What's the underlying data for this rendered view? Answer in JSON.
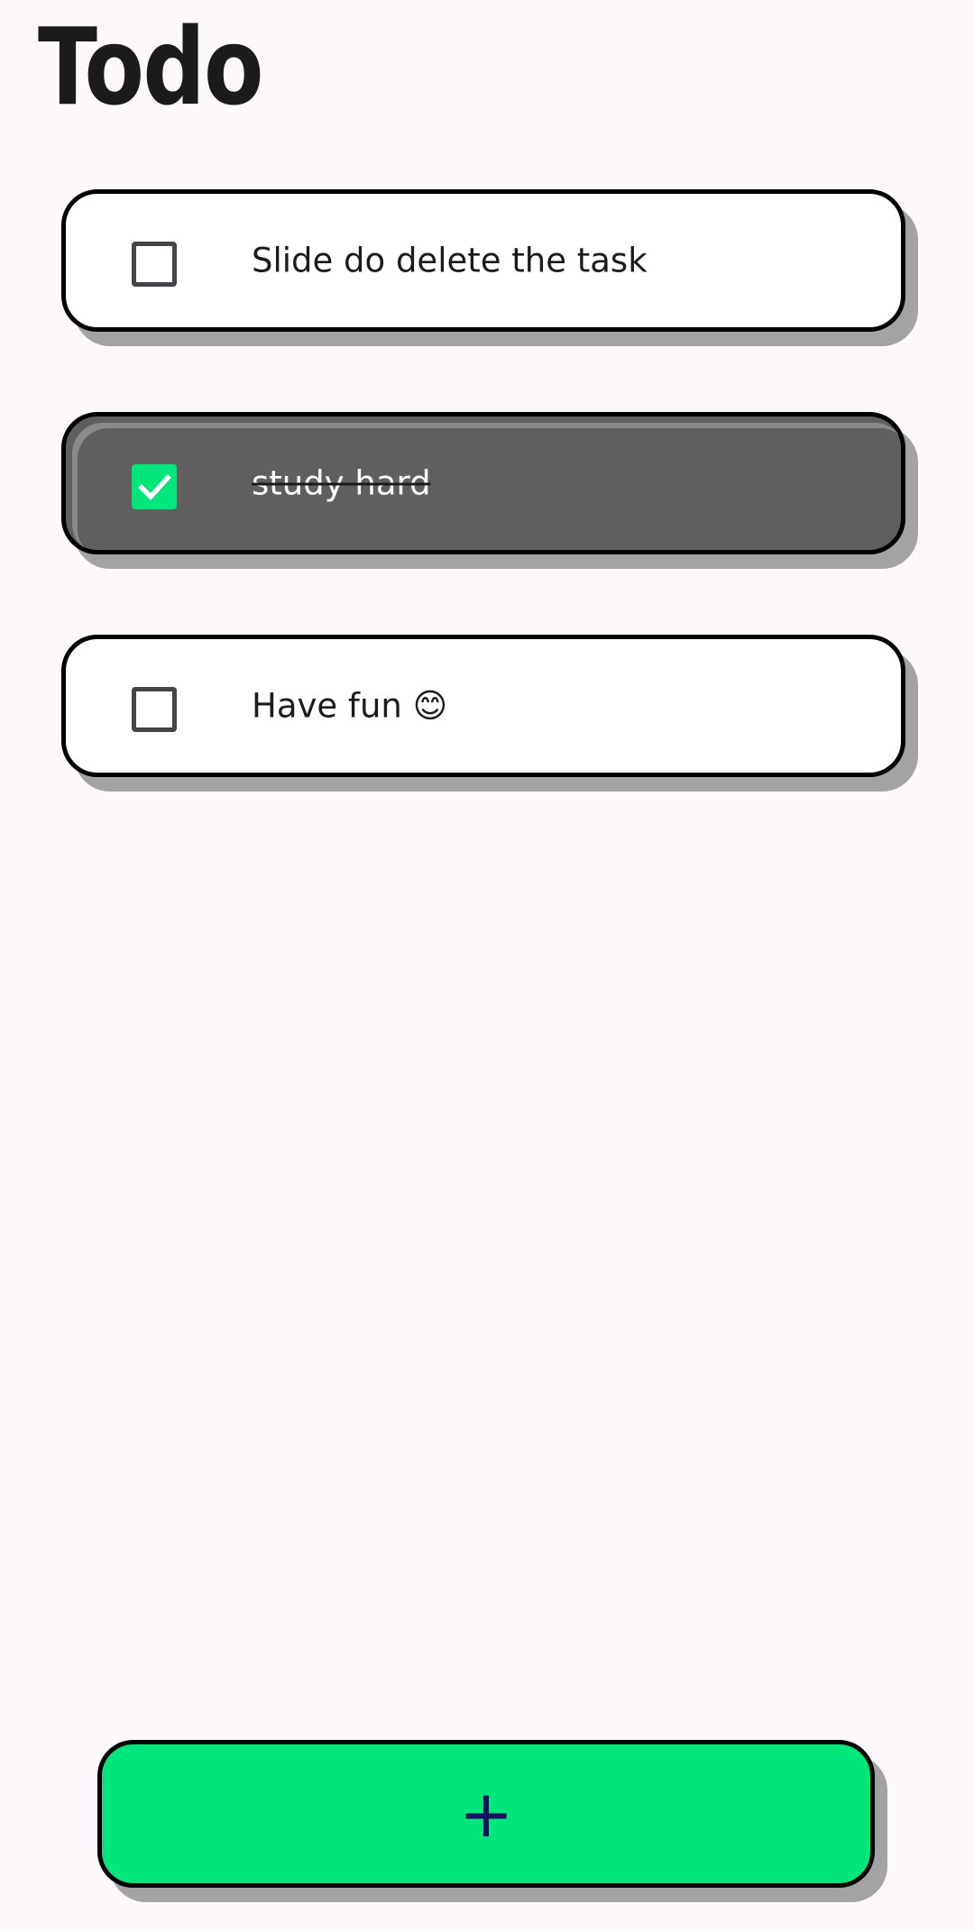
{
  "header": {
    "title": "Todo"
  },
  "tasks": [
    {
      "label": "Slide do delete the task",
      "completed": false
    },
    {
      "label": "study hard",
      "completed": true
    },
    {
      "label": "Have fun 😊",
      "completed": false
    }
  ],
  "add_button": {
    "label": "+",
    "icon": "plus-icon"
  },
  "colors": {
    "background": "#fdf8fb",
    "accent": "#00e67a",
    "completed_card": "#5f5f5f",
    "shadow": "#a3a3a3",
    "plus": "#1a1060"
  }
}
